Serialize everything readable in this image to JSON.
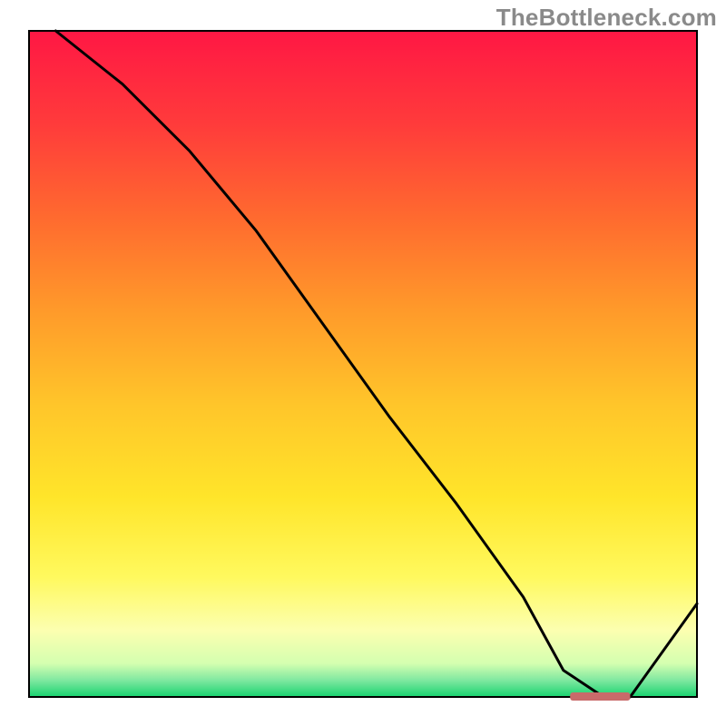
{
  "watermark": "TheBottleneck.com",
  "chart_data": {
    "type": "line",
    "title": "",
    "xlabel": "",
    "ylabel": "",
    "xlim": [
      0,
      100
    ],
    "ylim": [
      0,
      100
    ],
    "x": [
      4,
      14,
      24,
      34,
      44,
      54,
      64,
      74,
      80,
      86,
      90,
      100
    ],
    "values": [
      100,
      92,
      82,
      70,
      56,
      42,
      29,
      15,
      4,
      0,
      0,
      14
    ],
    "marker_segment": {
      "x_start": 81,
      "x_end": 90,
      "y": 0
    },
    "gradient_stops": [
      {
        "offset": 0.0,
        "color": "#ff1744"
      },
      {
        "offset": 0.14,
        "color": "#ff3b3b"
      },
      {
        "offset": 0.28,
        "color": "#ff6a2f"
      },
      {
        "offset": 0.42,
        "color": "#ff9a2a"
      },
      {
        "offset": 0.56,
        "color": "#ffc52a"
      },
      {
        "offset": 0.7,
        "color": "#ffe52a"
      },
      {
        "offset": 0.82,
        "color": "#fff95e"
      },
      {
        "offset": 0.9,
        "color": "#fcffb0"
      },
      {
        "offset": 0.95,
        "color": "#d4ffb0"
      },
      {
        "offset": 0.975,
        "color": "#7fe8a0"
      },
      {
        "offset": 1.0,
        "color": "#17d36f"
      }
    ]
  }
}
